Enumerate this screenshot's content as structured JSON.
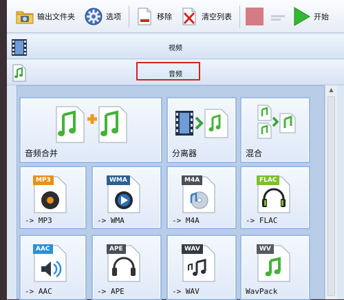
{
  "toolbar": {
    "output_folder_label": "输出文件夹",
    "options_label": "选项",
    "remove_label": "移除",
    "clear_list_label": "清空列表",
    "start_label": "开始"
  },
  "categories": {
    "video_label": "视频",
    "audio_label": "音频"
  },
  "tiles": [
    {
      "label": "音频合并",
      "icon": "audio-join-icon"
    },
    {
      "label": "分离器",
      "icon": "splitter-icon"
    },
    {
      "label": "混合",
      "icon": "mix-icon"
    },
    {
      "label": "-> MP3",
      "badge": "MP3",
      "badge_color": "#e8901a",
      "icon": "speaker-icon"
    },
    {
      "label": "-> WMA",
      "badge": "WMA",
      "badge_color": "#2c5f92",
      "icon": "disc-play-icon"
    },
    {
      "label": "-> M4A",
      "badge": "M4A",
      "badge_color": "#4b4f57",
      "icon": "cd-note-icon"
    },
    {
      "label": "-> FLAC",
      "badge": "FLAC",
      "badge_color": "#7cbf2c",
      "icon": "headphones-icon"
    },
    {
      "label": "-> AAC",
      "badge": "AAC",
      "badge_color": "#2d8fd9",
      "icon": "speaker-wave-icon"
    },
    {
      "label": "-> APE",
      "badge": "APE",
      "badge_color": "#4b4f57",
      "icon": "headphones-icon"
    },
    {
      "label": "-> WAV",
      "badge": "WAV",
      "badge_color": "#333a44",
      "icon": "notes-icon"
    },
    {
      "label": "WavPack",
      "badge": "WV",
      "badge_color": "#555b63",
      "icon": "green-note-icon"
    }
  ]
}
